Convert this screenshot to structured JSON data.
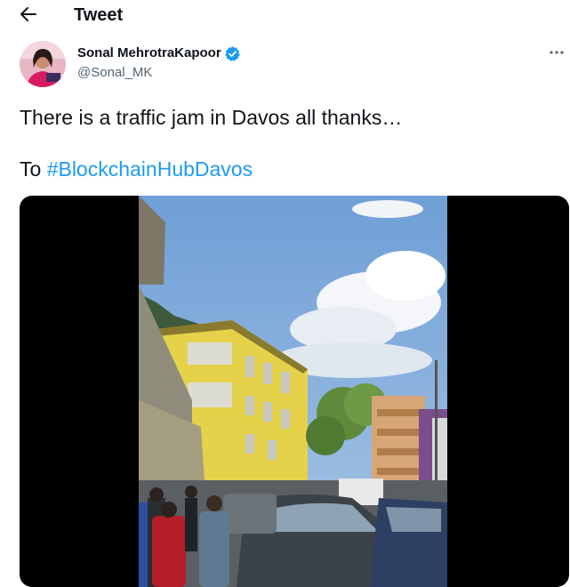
{
  "header": {
    "title": "Tweet",
    "back_icon": "arrow-left-icon"
  },
  "author": {
    "name": "Sonal MehrotraKapoor",
    "handle": "@Sonal_MK",
    "verified_icon": "verified-badge-icon",
    "avatar_icon": "avatar-photo"
  },
  "more_icon": "more-horizontal-icon",
  "tweet": {
    "line1": "There is a traffic jam in Davos all thanks…",
    "line2_prefix": "To ",
    "hashtag": "#BlockchainHubDavos"
  },
  "media": {
    "type": "video",
    "description_icon": "video-thumbnail"
  },
  "colors": {
    "accent": "#1d9bf0",
    "text": "#0f1419",
    "secondary": "#536471",
    "media_bg": "#000000"
  }
}
